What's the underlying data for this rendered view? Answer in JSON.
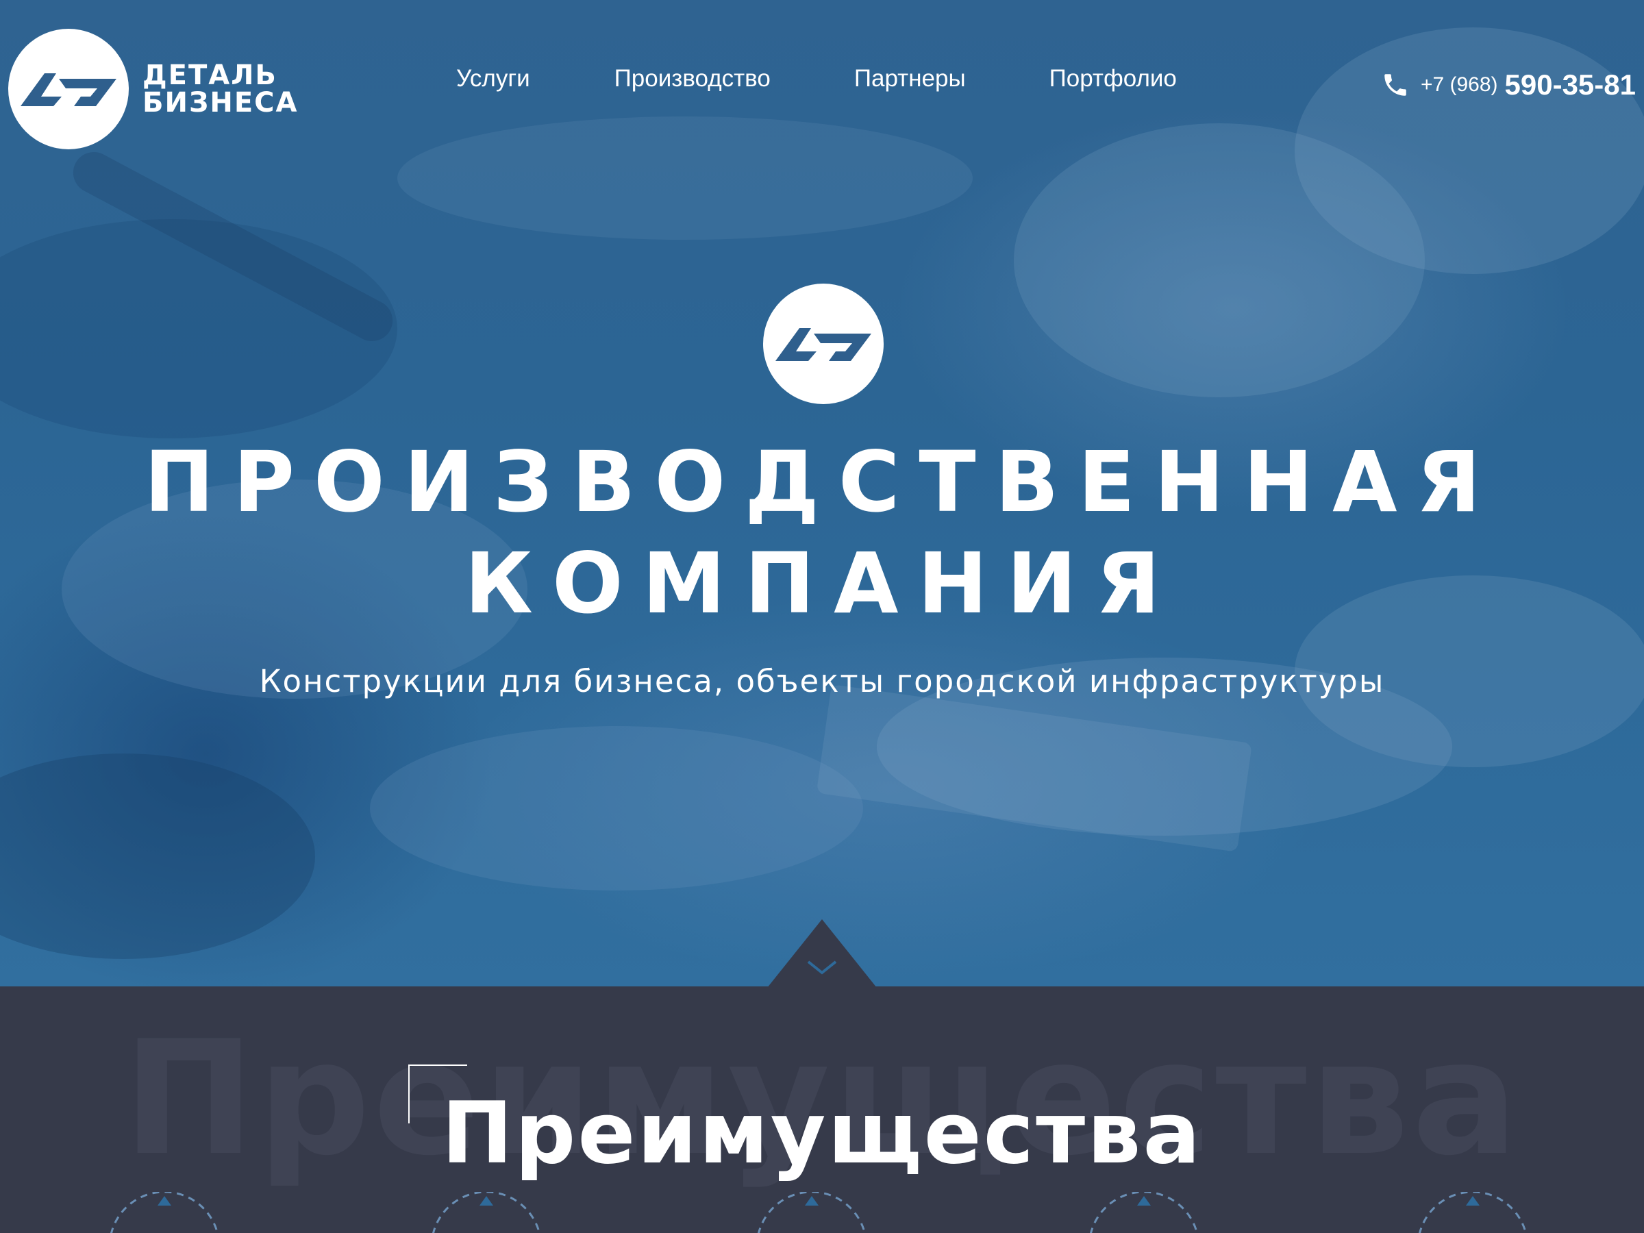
{
  "header": {
    "logo_lines": [
      "ДЕТАЛЬ",
      "БИЗНЕСА"
    ],
    "nav": [
      "Услуги",
      "Производство",
      "Партнеры",
      "Портфолио"
    ],
    "phone_prefix": "+7 (968)",
    "phone_number": "590-35-81"
  },
  "hero": {
    "title_lines": [
      "ПРОИЗВОДСТВЕННАЯ",
      "КОМПАНИЯ"
    ],
    "subtitle": "Конструкции для бизнеса, объекты городской инфраструктуры"
  },
  "advantages": {
    "background_word": "Преимущества",
    "title": "Преимущества"
  },
  "colors": {
    "hero_blue": "#2e6a9a",
    "dark_section": "#363a4a",
    "accent_white": "#ffffff"
  },
  "icons": [
    "logo-mark-icon",
    "phone-icon",
    "chevron-down-icon"
  ]
}
